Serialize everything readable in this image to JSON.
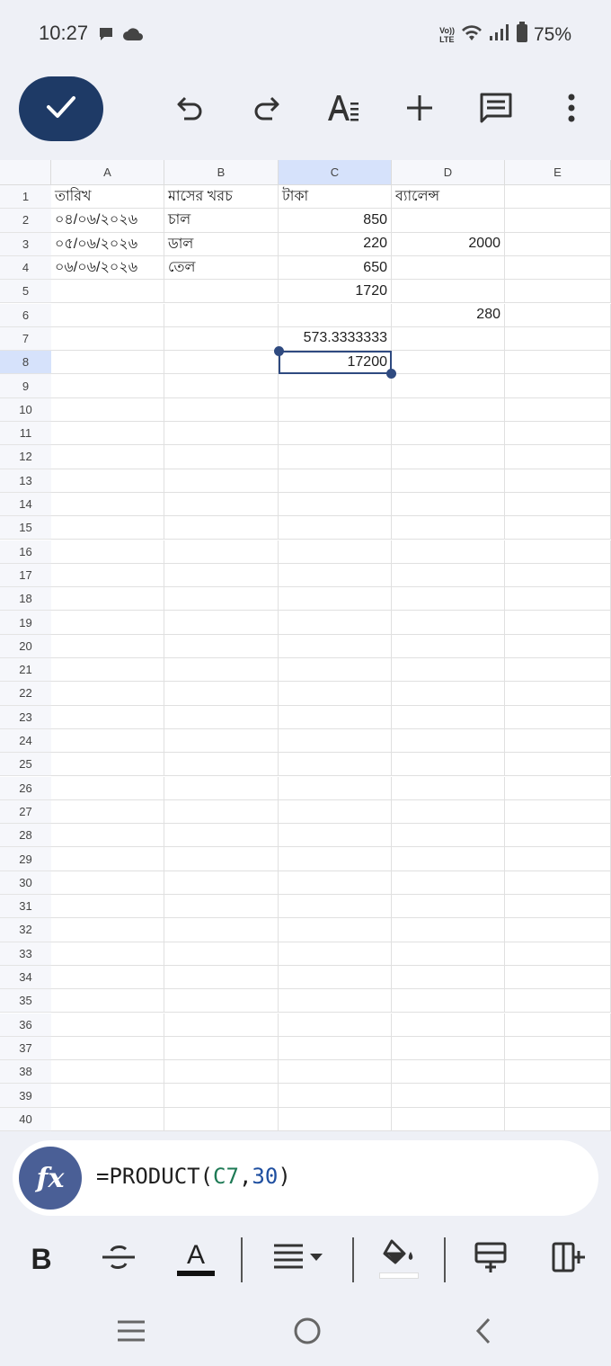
{
  "status": {
    "time": "10:27",
    "volte_line1": "Vo))",
    "volte_line2": "LTE",
    "battery": "75%"
  },
  "columns": [
    "A",
    "B",
    "C",
    "D",
    "E"
  ],
  "rows": [
    {
      "n": "1",
      "A": "তারিখ",
      "B": "মাসের খরচ",
      "C": "টাকা",
      "D": "ব্যালেন্স",
      "E": ""
    },
    {
      "n": "2",
      "A": "০৪/০৬/২০২৬",
      "B": "চাল",
      "C": "850",
      "D": "",
      "E": ""
    },
    {
      "n": "3",
      "A": "০৫/০৬/২০২৬",
      "B": "ডাল",
      "C": "220",
      "D": "2000",
      "E": ""
    },
    {
      "n": "4",
      "A": "০৬/০৬/২০২৬",
      "B": "তেল",
      "C": "650",
      "D": "",
      "E": ""
    },
    {
      "n": "5",
      "A": "",
      "B": "",
      "C": "1720",
      "D": "",
      "E": ""
    },
    {
      "n": "6",
      "A": "",
      "B": "",
      "C": "",
      "D": "280",
      "E": ""
    },
    {
      "n": "7",
      "A": "",
      "B": "",
      "C": "573.3333333",
      "D": "",
      "E": ""
    },
    {
      "n": "8",
      "A": "",
      "B": "",
      "C": "17200",
      "D": "",
      "E": ""
    },
    {
      "n": "9"
    },
    {
      "n": "10"
    },
    {
      "n": "11"
    },
    {
      "n": "12"
    },
    {
      "n": "13"
    },
    {
      "n": "14"
    },
    {
      "n": "15"
    },
    {
      "n": "16"
    },
    {
      "n": "17"
    },
    {
      "n": "18"
    },
    {
      "n": "19"
    },
    {
      "n": "20"
    },
    {
      "n": "21"
    },
    {
      "n": "22"
    },
    {
      "n": "23"
    },
    {
      "n": "24"
    },
    {
      "n": "25"
    },
    {
      "n": "26"
    },
    {
      "n": "27"
    },
    {
      "n": "28"
    },
    {
      "n": "29"
    },
    {
      "n": "30"
    },
    {
      "n": "31"
    },
    {
      "n": "32"
    },
    {
      "n": "33"
    },
    {
      "n": "34"
    },
    {
      "n": "35"
    },
    {
      "n": "36"
    },
    {
      "n": "37"
    },
    {
      "n": "38"
    },
    {
      "n": "39"
    },
    {
      "n": "40"
    }
  ],
  "selected_cell": "C8",
  "formula": {
    "prefix": "=PRODUCT(",
    "ref": "C7",
    "comma": ",",
    "arg": "30",
    "suffix": ")"
  },
  "fx_label": "fx",
  "format": {
    "bold": "B",
    "text_color": "A"
  },
  "colors": {
    "accent": "#1e3a66",
    "selection": "#2f4a80",
    "header_selected": "#d6e2fb"
  },
  "icons": [
    "check-icon",
    "undo-icon",
    "redo-icon",
    "text-format-icon",
    "add-icon",
    "comment-icon",
    "more-vert-icon",
    "bold-icon",
    "strikethrough-icon",
    "text-color-icon",
    "align-icon",
    "fill-color-icon",
    "insert-row-icon",
    "insert-column-icon"
  ]
}
